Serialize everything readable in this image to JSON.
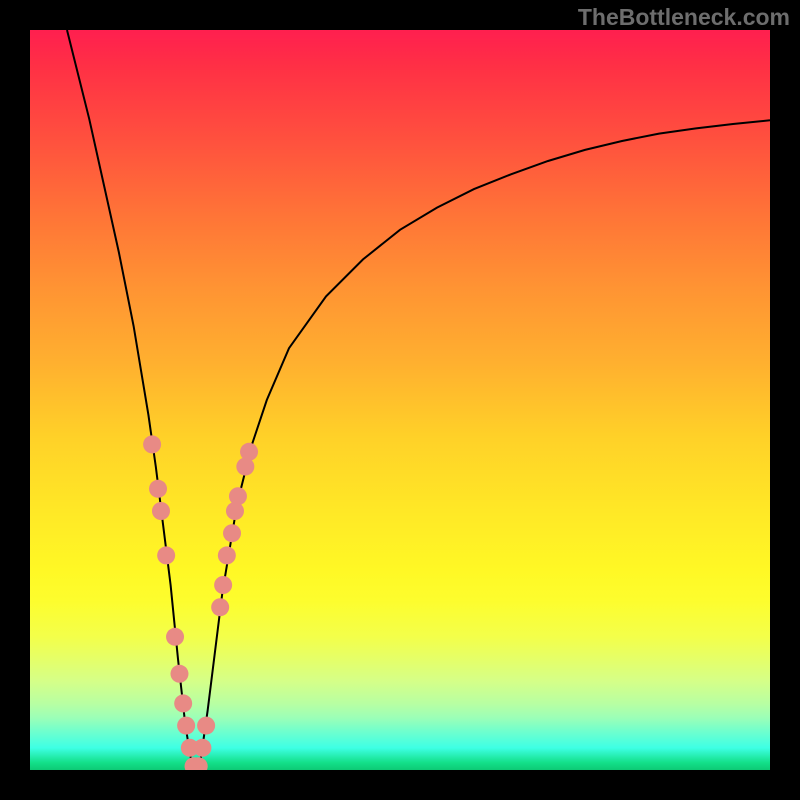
{
  "watermark_text": "TheBottleneck.com",
  "chart_data": {
    "type": "line",
    "title": "",
    "xlabel": "",
    "ylabel": "",
    "xlim": [
      0,
      100
    ],
    "ylim": [
      0,
      100
    ],
    "series": [
      {
        "name": "bottleneck-curve",
        "description": "V-shaped bottleneck percentage curve with minimum near x=22",
        "x": [
          5,
          8,
          10,
          12,
          14,
          15,
          16,
          17,
          18,
          19,
          20,
          21,
          22,
          23,
          24,
          25,
          26,
          27,
          28,
          30,
          32,
          35,
          40,
          45,
          50,
          55,
          60,
          65,
          70,
          75,
          80,
          85,
          90,
          95,
          100
        ],
        "y": [
          100,
          88,
          79,
          70,
          60,
          54,
          48,
          41,
          33,
          25,
          15,
          6,
          0,
          1,
          8,
          16,
          24,
          30,
          36,
          44,
          50,
          57,
          64,
          69,
          73,
          76,
          78.5,
          80.5,
          82.3,
          83.8,
          85,
          86,
          86.7,
          87.3,
          87.8
        ]
      }
    ],
    "highlighted_points": {
      "name": "highlighted-range-dots",
      "description": "Salmon colored dots highlighting regions on the curve near the minimum",
      "points": [
        {
          "x": 16.5,
          "y": 44
        },
        {
          "x": 17.3,
          "y": 38
        },
        {
          "x": 17.7,
          "y": 35
        },
        {
          "x": 18.4,
          "y": 29
        },
        {
          "x": 19.6,
          "y": 18
        },
        {
          "x": 20.2,
          "y": 13
        },
        {
          "x": 20.7,
          "y": 9
        },
        {
          "x": 21.1,
          "y": 6
        },
        {
          "x": 21.6,
          "y": 3
        },
        {
          "x": 22.1,
          "y": 0.5
        },
        {
          "x": 22.8,
          "y": 0.5
        },
        {
          "x": 23.3,
          "y": 3
        },
        {
          "x": 23.8,
          "y": 6
        },
        {
          "x": 25.7,
          "y": 22
        },
        {
          "x": 26.1,
          "y": 25
        },
        {
          "x": 26.6,
          "y": 29
        },
        {
          "x": 27.3,
          "y": 32
        },
        {
          "x": 27.7,
          "y": 35
        },
        {
          "x": 28.1,
          "y": 37
        },
        {
          "x": 29.1,
          "y": 41
        },
        {
          "x": 29.6,
          "y": 43
        }
      ]
    }
  }
}
